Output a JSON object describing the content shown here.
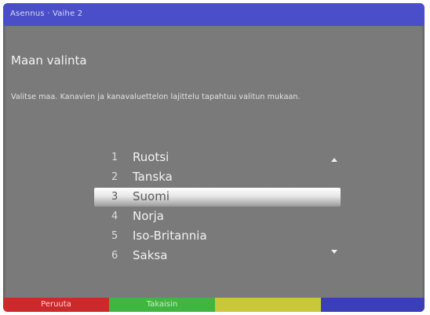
{
  "header": {
    "breadcrumb": "Asennus · Vaihe 2"
  },
  "page": {
    "title": "Maan valinta",
    "description": "Valitse maa. Kanavien ja kanavaluettelon lajittelu tapahtuu valitun mukaan."
  },
  "country_list": {
    "selected_index": 2,
    "items": [
      {
        "num": "1",
        "name": "Ruotsi"
      },
      {
        "num": "2",
        "name": "Tanska"
      },
      {
        "num": "3",
        "name": "Suomi"
      },
      {
        "num": "4",
        "name": "Norja"
      },
      {
        "num": "5",
        "name": "Iso-Britannia"
      },
      {
        "num": "6",
        "name": "Saksa"
      }
    ]
  },
  "footer": {
    "red_label": "Peruuta",
    "green_label": "Takaisin",
    "yellow_label": "",
    "blue_label": ""
  },
  "colors": {
    "red": "#cc2a2a",
    "green": "#3fb63f",
    "yellow": "#c8c83a",
    "blue": "#3a3eb8",
    "header": "#4a4ec8",
    "background": "#7a7a7a"
  }
}
